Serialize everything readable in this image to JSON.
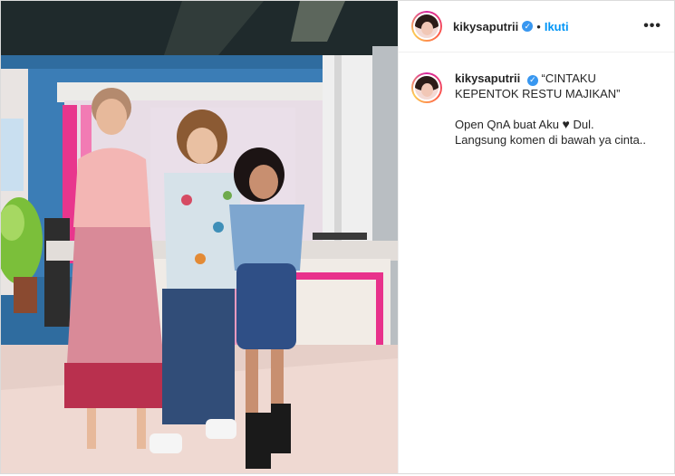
{
  "post": {
    "username": "kikysaputrii",
    "separator": "•",
    "follow_label": "Ikuti",
    "more_label": "•••",
    "caption_title": "“CINTAKU KEPENTOK RESTU MAJIKAN”",
    "caption_line1_a": "Open QnA buat Aku",
    "caption_heart": "♥",
    "caption_line1_b": "Dul.",
    "caption_line2": "Langsung komen di bawah ya cinta.."
  },
  "icons": {
    "verified": "verified-badge-icon",
    "more": "more-options-icon",
    "heart": "black-heart-icon"
  },
  "colors": {
    "link_blue": "#0095f6",
    "verified_blue": "#3897f0",
    "text": "#262626",
    "border": "#dbdbdb"
  }
}
